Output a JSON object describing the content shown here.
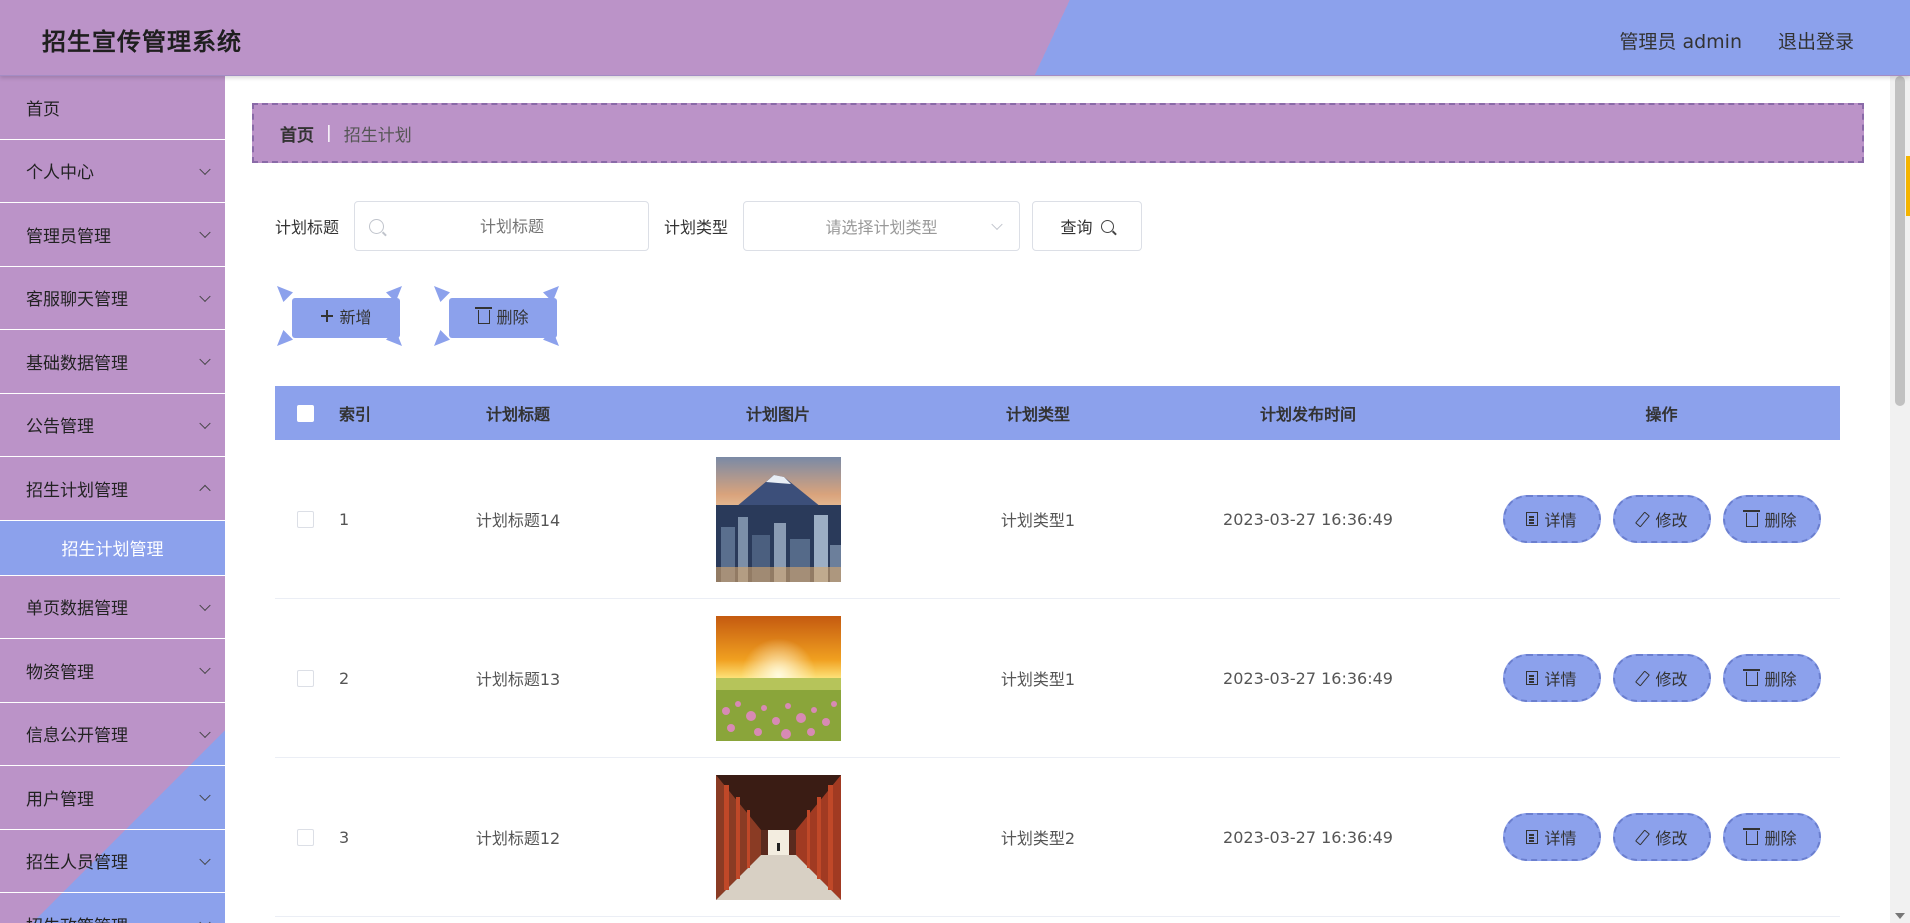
{
  "header": {
    "title": "招生宣传管理系统",
    "user": "管理员 admin",
    "logout": "退出登录"
  },
  "sidebar": {
    "items": [
      {
        "label": "首页",
        "has_arrow": false
      },
      {
        "label": "个人中心",
        "has_arrow": true
      },
      {
        "label": "管理员管理",
        "has_arrow": true
      },
      {
        "label": "客服聊天管理",
        "has_arrow": true
      },
      {
        "label": "基础数据管理",
        "has_arrow": true
      },
      {
        "label": "公告管理",
        "has_arrow": true
      },
      {
        "label": "招生计划管理",
        "has_arrow": true
      },
      {
        "label": "单页数据管理",
        "has_arrow": true
      },
      {
        "label": "物资管理",
        "has_arrow": true
      },
      {
        "label": "信息公开管理",
        "has_arrow": true
      },
      {
        "label": "用户管理",
        "has_arrow": true
      },
      {
        "label": "招生人员管理",
        "has_arrow": true
      },
      {
        "label": "招生政策管理",
        "has_arrow": true
      }
    ],
    "active_sub": "招生计划管理"
  },
  "breadcrumb": {
    "home": "首页",
    "separator": "|",
    "current": "招生计划"
  },
  "search": {
    "title_label": "计划标题",
    "title_placeholder": "计划标题",
    "type_label": "计划类型",
    "type_placeholder": "请选择计划类型",
    "query_label": "查询"
  },
  "actions": {
    "add_label": "新增",
    "delete_label": "删除"
  },
  "table": {
    "headers": {
      "index": "索引",
      "title": "计划标题",
      "image": "计划图片",
      "type": "计划类型",
      "time": "计划发布时间",
      "ops": "操作"
    },
    "rows": [
      {
        "index": "1",
        "title": "计划标题14",
        "image": "mountain-city-photo",
        "type": "计划类型1",
        "time": "2023-03-27 16:36:49"
      },
      {
        "index": "2",
        "title": "计划标题13",
        "image": "sunset-flower-field-photo",
        "type": "计划类型1",
        "time": "2023-03-27 16:36:49"
      },
      {
        "index": "3",
        "title": "计划标题12",
        "image": "red-pillar-corridor-photo",
        "type": "计划类型2",
        "time": "2023-03-27 16:36:49"
      }
    ],
    "ops": {
      "detail": "详情",
      "edit": "修改",
      "delete": "删除"
    }
  },
  "colors": {
    "purple": "#bb93c8",
    "blue": "#8ca1ec"
  }
}
